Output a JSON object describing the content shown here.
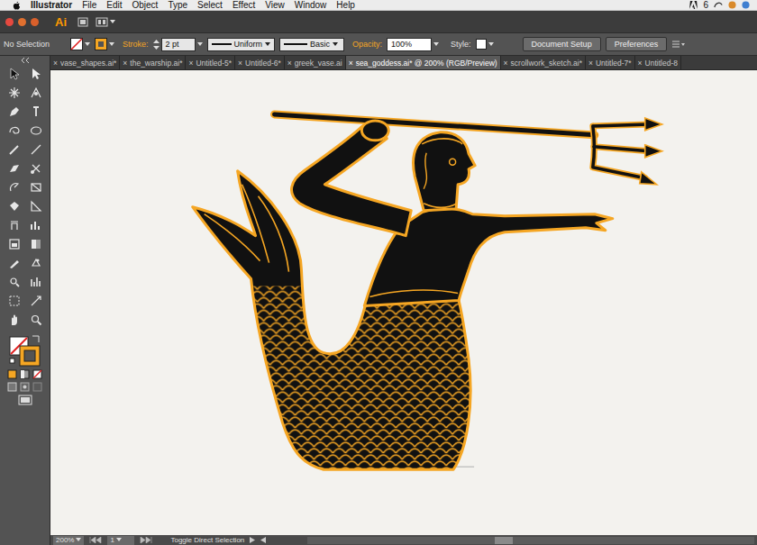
{
  "menubar": {
    "items": [
      "Illustrator",
      "File",
      "Edit",
      "Object",
      "Type",
      "Select",
      "Effect",
      "View",
      "Window",
      "Help"
    ],
    "badge": "6"
  },
  "app_bar": {
    "logo": "Ai"
  },
  "control_bar": {
    "selection": "No Selection",
    "stroke_label": "Stroke:",
    "stroke_weight": "2 pt",
    "profile": "Uniform",
    "brush": "Basic",
    "opacity_label": "Opacity:",
    "opacity": "100%",
    "style_label": "Style:",
    "buttons": [
      "Document Setup",
      "Preferences"
    ]
  },
  "tabs": [
    {
      "label": "vase_shapes.ai*",
      "close": "×",
      "selected": false
    },
    {
      "label": "the_warship.ai*",
      "close": "×",
      "selected": false
    },
    {
      "label": "Untitled-5*",
      "close": "×",
      "selected": false
    },
    {
      "label": "Untitled-6*",
      "close": "×",
      "selected": false
    },
    {
      "label": "greek_vase.ai",
      "close": "×",
      "selected": false
    },
    {
      "label": "sea_goddess.ai* @ 200% (RGB/Preview)",
      "close": "×",
      "selected": true
    },
    {
      "label": "scrollwork_sketch.ai*",
      "close": "×",
      "selected": false
    },
    {
      "label": "Untitled-7*",
      "close": "×",
      "selected": false
    },
    {
      "label": "Untitled-8",
      "close": "×",
      "selected": false
    }
  ],
  "status_bar": {
    "zoom": "200%",
    "page": "1",
    "message": "Toggle Direct Selection"
  }
}
